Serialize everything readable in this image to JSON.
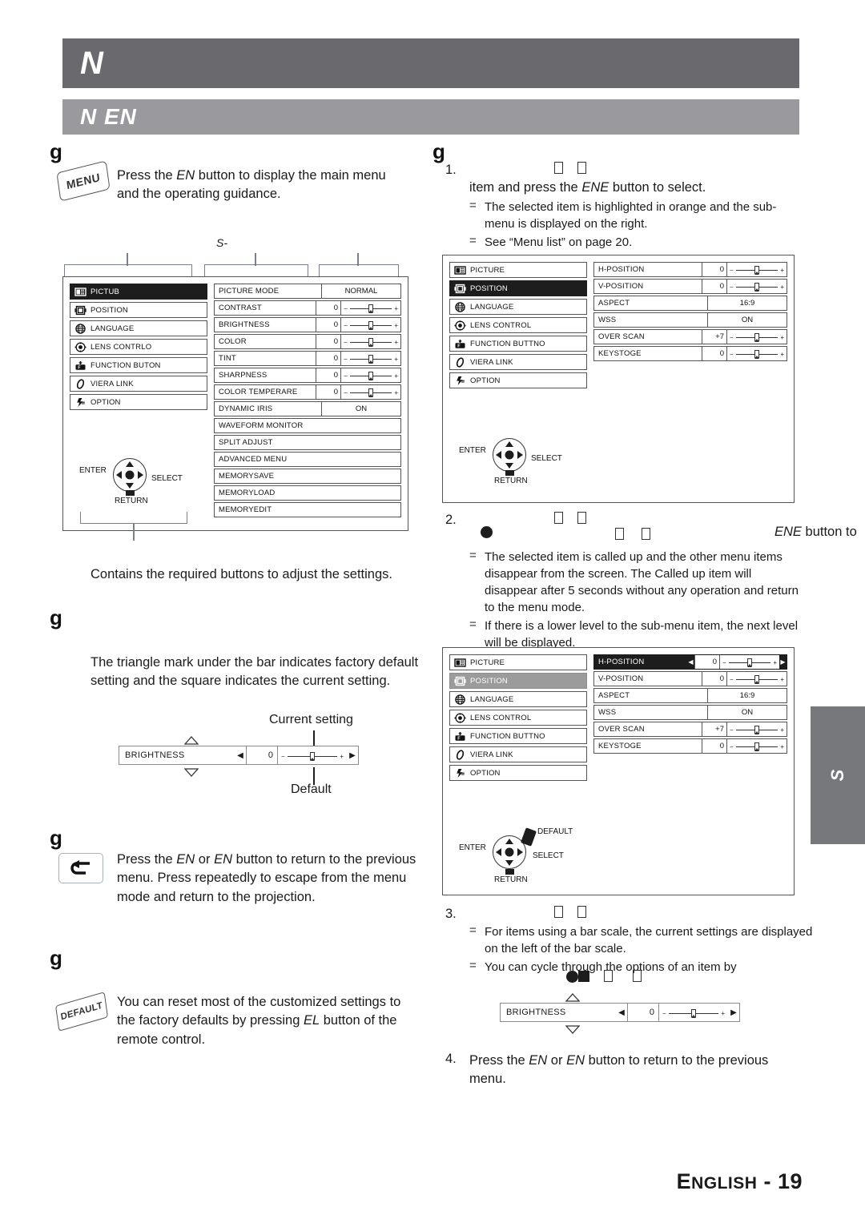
{
  "header": {
    "title": "N",
    "subtitle": "N  EN"
  },
  "left_column": {
    "section1_marker": "g",
    "menu_key_label": "MENU",
    "menu_note": "Press the EN button to display the main menu and the operating guidance.",
    "menu_note_italic": "EN",
    "bracket_label": "S-",
    "caption": "Contains the required buttons to adjust the settings.",
    "section2_marker": "g",
    "bar_explain": "The triangle mark under the bar indicates factory default setting and the square indicates the current setting.",
    "label_current": "Current setting",
    "label_default": "Default",
    "section3_marker": "g",
    "return_note": "Press the EN or EN button to return to the previous menu. Press repeatedly to escape from the menu mode and return to the projection.",
    "section4_marker": "g",
    "default_key_label": "DEFAULT",
    "default_note": "You can reset most of the customized settings to the factory defaults by pressing EL button of the remote control.",
    "brightness_example": {
      "name": "BRIGHTNESS",
      "value": "0",
      "minus": "−",
      "plus": "+",
      "left_arrow": "◀",
      "right_arrow": "▶"
    }
  },
  "right_column": {
    "section_marker": "g",
    "step1": {
      "number": "1.",
      "lead_text": "",
      "main_text": "item and press the ENE button to select.",
      "italic_token": "ENE",
      "notes": [
        "The selected item is highlighted in orange and the sub-menu is displayed on the right.",
        "See “Menu list” on page 20."
      ]
    },
    "step2": {
      "number": "2.",
      "trailing_text": "ENE button to",
      "italic_token": "ENE",
      "notes": [
        "The selected item is called up and the other menu items disappear from the screen. The Called up item will disappear after 5 seconds without any operation and return to the menu mode.",
        "If there is a lower level to the sub-menu item, the next level will be displayed."
      ]
    },
    "step3": {
      "number": "3.",
      "notes": [
        "For items using a bar scale, the current settings are displayed on the left of the bar scale.",
        "You can cycle through the options of an item by"
      ],
      "brightness_example": {
        "name": "BRIGHTNESS",
        "value": "0",
        "minus": "−",
        "plus": "+",
        "left_arrow": "◀",
        "right_arrow": "▶"
      }
    },
    "step4": {
      "number": "4.",
      "text": "Press the EN or EN button to return to the previous menu."
    }
  },
  "osd_menus": {
    "main_items": [
      {
        "label": "PICTUB",
        "icon": "picture-icon"
      },
      {
        "label": "POSITION",
        "icon": "position-icon"
      },
      {
        "label": "LANGUAGE",
        "icon": "globe-icon"
      },
      {
        "label": "LENS CONTRLO",
        "icon": "lens-icon"
      },
      {
        "label": "FUNCTION BUTON",
        "icon": "function-button-icon"
      },
      {
        "label": "VIERA LINK",
        "icon": "viera-link-icon"
      },
      {
        "label": "OPTION",
        "icon": "option-icon"
      }
    ],
    "position_items": [
      {
        "label": "PICTURE",
        "icon": "picture-icon"
      },
      {
        "label": "POSITION",
        "icon": "position-icon"
      },
      {
        "label": "LANGUAGE",
        "icon": "globe-icon"
      },
      {
        "label": "LENS CONTROL",
        "icon": "lens-icon"
      },
      {
        "label": "FUNCTION BUTTNO",
        "icon": "function-button-icon"
      },
      {
        "label": "VIERA LINK",
        "icon": "viera-link-icon"
      },
      {
        "label": "OPTION",
        "icon": "option-icon"
      }
    ],
    "picture_submenu": [
      {
        "name": "PICTURE MODE",
        "type": "value",
        "value": "NORMAL"
      },
      {
        "name": "CONTRAST",
        "type": "bar",
        "value": "0"
      },
      {
        "name": "BRIGHTNESS",
        "type": "bar",
        "value": "0"
      },
      {
        "name": "COLOR",
        "type": "bar",
        "value": "0"
      },
      {
        "name": "TINT",
        "type": "bar",
        "value": "0"
      },
      {
        "name": "SHARPNESS",
        "type": "bar",
        "value": "0"
      },
      {
        "name": "COLOR TEMPERARE",
        "type": "bar",
        "value": "0"
      },
      {
        "name": "DYNAMIC IRIS",
        "type": "value",
        "value": "ON"
      },
      {
        "name": "WAVEFORM MONITOR",
        "type": "plain",
        "value": ""
      },
      {
        "name": "SPLIT ADJUST",
        "type": "plain",
        "value": ""
      },
      {
        "name": "ADVANCED MENU",
        "type": "plain",
        "value": ""
      },
      {
        "name": "MEMORYSAVE",
        "type": "plain",
        "value": ""
      },
      {
        "name": "MEMORYLOAD",
        "type": "plain",
        "value": ""
      },
      {
        "name": "MEMORYEDIT",
        "type": "plain",
        "value": ""
      }
    ],
    "position_submenu": [
      {
        "name": "H-POSITION",
        "type": "bar",
        "value": "0"
      },
      {
        "name": "V-POSITION",
        "type": "bar",
        "value": "0"
      },
      {
        "name": "ASPECT",
        "type": "value",
        "value": "16:9"
      },
      {
        "name": "WSS",
        "type": "value",
        "value": "ON"
      },
      {
        "name": "OVER SCAN",
        "type": "bar",
        "value": "+7"
      },
      {
        "name": "KEYSTOGE",
        "type": "bar",
        "value": "0"
      }
    ],
    "guidance": {
      "enter": "ENTER",
      "select": "SELECT",
      "return": "RETURN",
      "default": "DEFAULT"
    }
  },
  "side_tab": {
    "label": "S"
  },
  "footer": {
    "language": "E",
    "language_rest": "NGLISH",
    "separator": " - ",
    "page": "19"
  },
  "colors": {
    "header_dark": "#6a6a6e",
    "header_light": "#9a9a9e",
    "side_tab": "#76787c",
    "selected_black": "#1d1d1d",
    "selected_gray": "#9b9b9b"
  }
}
